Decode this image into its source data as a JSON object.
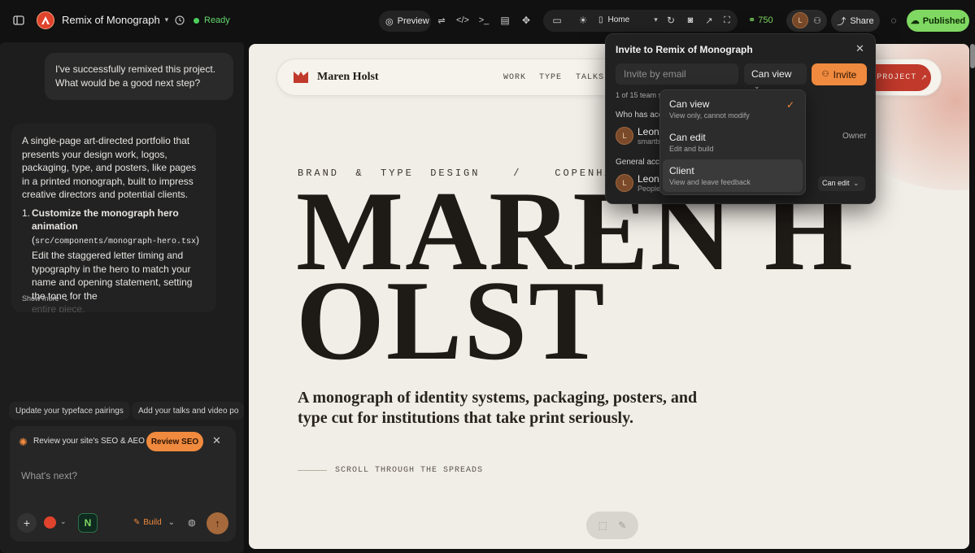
{
  "topbar": {
    "project_name": "Remix of Monograph",
    "status": "Ready",
    "preview_label": "Preview",
    "route": "Home",
    "credits": "750",
    "avatar_initial": "L",
    "share_label": "Share",
    "published_label": "Published"
  },
  "chat": {
    "user_message": "I've successfully remixed this project. What would be a good next step?",
    "assistant_intro": "A single-page art-directed portfolio that presents your design work, logos, packaging, type, and posters, like pages in a printed monograph, built to impress creative directors and potential clients.",
    "step_number": "1.",
    "step_title": "Customize the monograph hero animation",
    "step_code": "src/components/monograph-hero.tsx",
    "step_text_a": " Edit the staggered letter timing and typography in the hero to match your name and opening statement, setting the tone for the",
    "step_text_b": "entire piece.",
    "show_more": "Show more"
  },
  "suggestions": [
    "Update your typeface pairings",
    "Add your talks and video po"
  ],
  "composer": {
    "seo_text": "Review your site's SEO & AEO",
    "seo_button": "Review SEO",
    "placeholder": "What's next?",
    "build_label": "Build"
  },
  "site": {
    "brand": "Maren Holst",
    "nav": [
      "WORK",
      "TYPE",
      "TALKS"
    ],
    "cta": "PROJECT",
    "kicker": "BRAND  &  TYPE  DESIGN    /    COPENHAGEN    /    EST",
    "hero_line1": "MAREN H",
    "hero_line2": "OLST",
    "subtitle_1": "A monograph of identity systems, packaging, posters, and",
    "subtitle_2": "type cut for institutions that take print seriously.",
    "scroll_label": "SCROLL THROUGH THE SPREADS"
  },
  "invite": {
    "title": "Invite to Remix of Monograph",
    "email_placeholder": "Invite by email",
    "permission": "Can view",
    "invite_button": "Invite",
    "seat_count": "1 of 15 team s",
    "who_has_access": "Who has acc",
    "member_name": "Leon",
    "member_email": "smartb",
    "owner_label": "Owner",
    "general_access": "General acc",
    "general_name": "Leon",
    "general_sub": "People",
    "general_permission": "Can edit"
  },
  "permission_menu": [
    {
      "label": "Can view",
      "desc": "View only, cannot modify"
    },
    {
      "label": "Can edit",
      "desc": "Edit and build"
    },
    {
      "label": "Client",
      "desc": "View and leave feedback"
    }
  ],
  "colors": {
    "accent_orange": "#f08a3e",
    "published_green": "#7fd861",
    "site_red": "#c0392b",
    "ink": "#1e1a16"
  }
}
